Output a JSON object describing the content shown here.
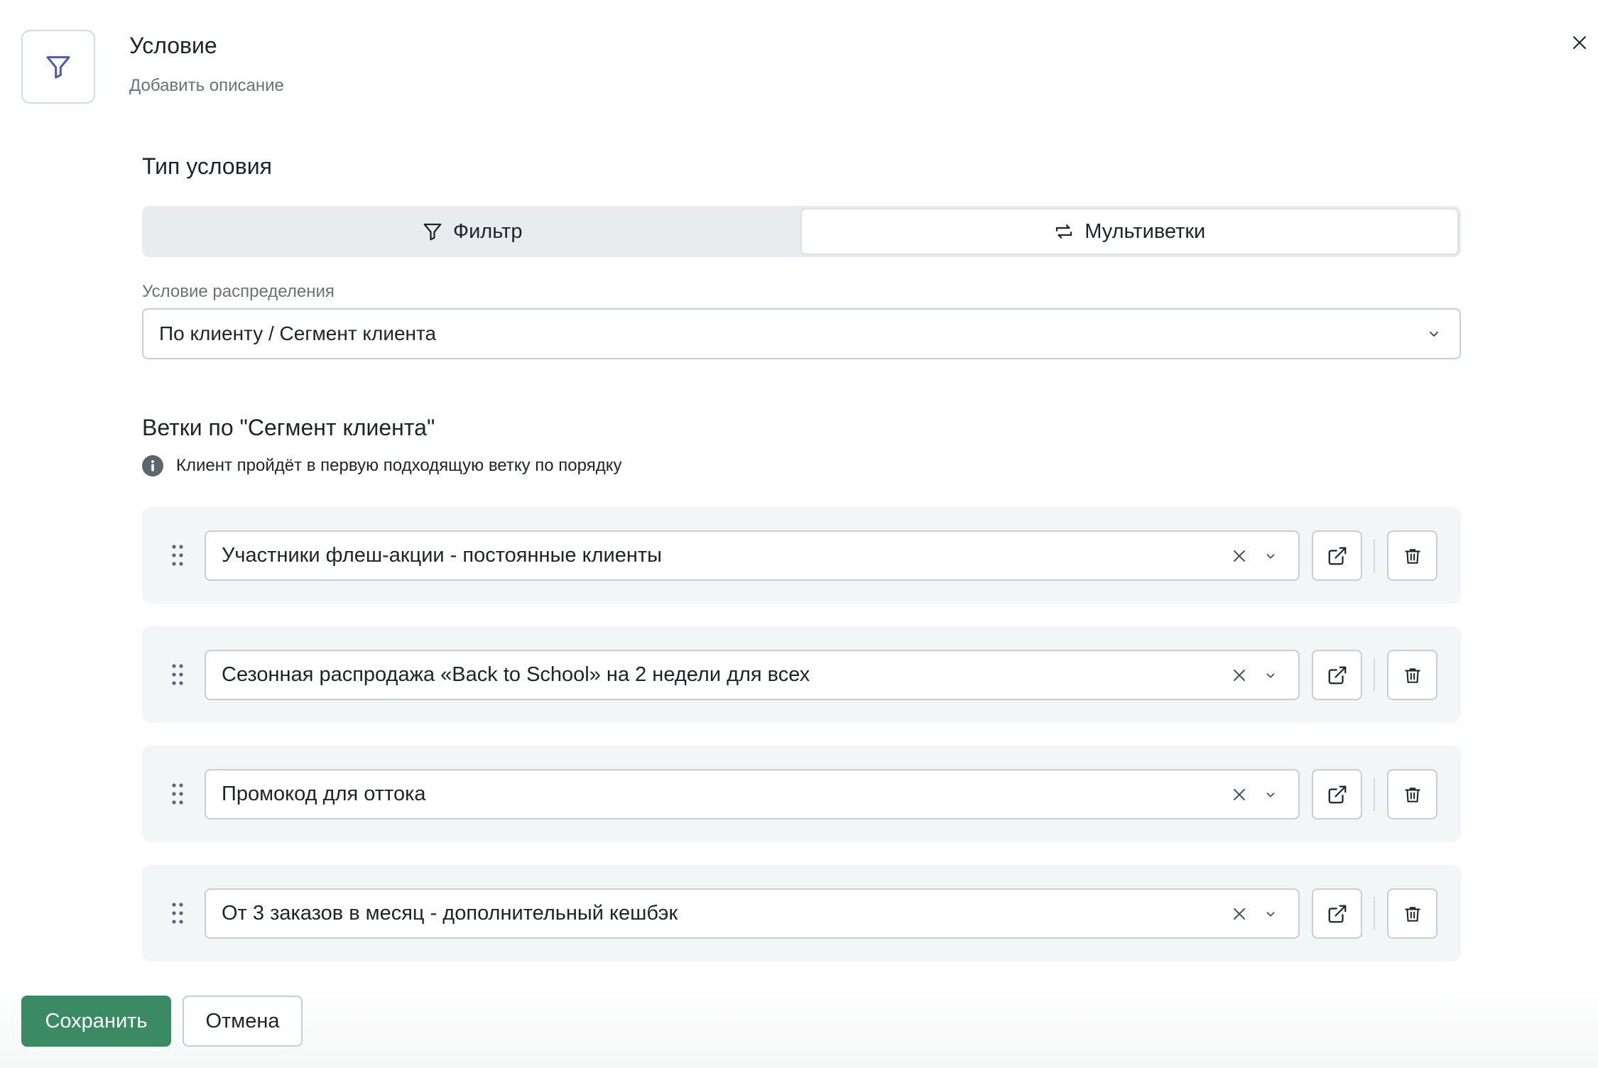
{
  "header": {
    "title": "Условие",
    "subtitle": "Добавить описание"
  },
  "condition_type": {
    "heading": "Тип условия",
    "tabs": [
      {
        "label": "Фильтр",
        "icon": "filter-icon",
        "active": false
      },
      {
        "label": "Мультиветки",
        "icon": "branches-icon",
        "active": true
      }
    ]
  },
  "distribution": {
    "label": "Условие распределения",
    "value": "По клиенту / Сегмент клиента"
  },
  "branches": {
    "heading": "Ветки по \"Сегмент клиента\"",
    "info": "Клиент пройдёт в первую подходящую ветку по порядку",
    "items": [
      {
        "value": "Участники флеш-акции - постоянные клиенты"
      },
      {
        "value": "Сезонная распродажа «Back to School» на 2 недели для всех"
      },
      {
        "value": "Промокод для оттока"
      },
      {
        "value": "От 3 заказов в месяц - дополнительный кешбэк"
      }
    ]
  },
  "footer": {
    "save_label": "Сохранить",
    "cancel_label": "Отмена"
  },
  "colors": {
    "primary": "#3a8a64",
    "icon_blue": "#4a5bb5",
    "card_bg": "#f3f6f7",
    "border": "#c9ced2"
  }
}
